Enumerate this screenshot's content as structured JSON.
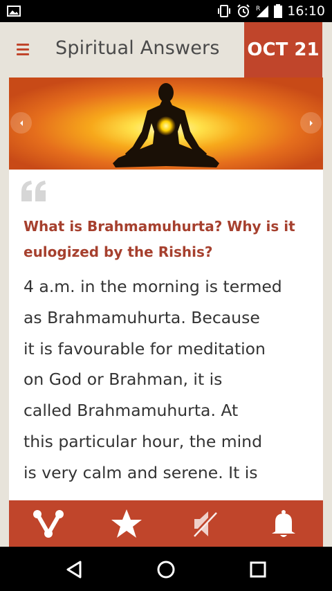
{
  "status_bar": {
    "time": "16:10",
    "icons": [
      "image-icon",
      "vibrate-icon",
      "alarm-icon",
      "signal-icon",
      "battery-icon"
    ]
  },
  "header": {
    "title": "Spiritual Answers",
    "date": "OCT 21",
    "menu_icon": "hamburger-menu-icon"
  },
  "banner": {
    "image": "meditating-figure-on-orange-glow",
    "prev_icon": "chevron-left-icon",
    "next_icon": "chevron-right-icon"
  },
  "card": {
    "quote_icon": "open-quote-icon",
    "question": "What is Brahmamuhurta? Why is it eulogized by the Rishis?",
    "answer_lines": [
      "4 a.m. in the morning is termed",
      "as Brahmamuhurta. Because",
      "it is favourable for meditation",
      "on God or Brahman, it is",
      "called Brahmamuhurta. At",
      "this particular hour, the mind",
      "is very calm and serene. It is"
    ]
  },
  "actions": [
    "share-icon",
    "star-icon",
    "sound-off-icon",
    "bell-icon"
  ],
  "nav": [
    "back-icon",
    "home-icon",
    "recents-icon"
  ],
  "colors": {
    "accent": "#c0452b",
    "question_text": "#a6402e",
    "background": "#e7e3da"
  }
}
